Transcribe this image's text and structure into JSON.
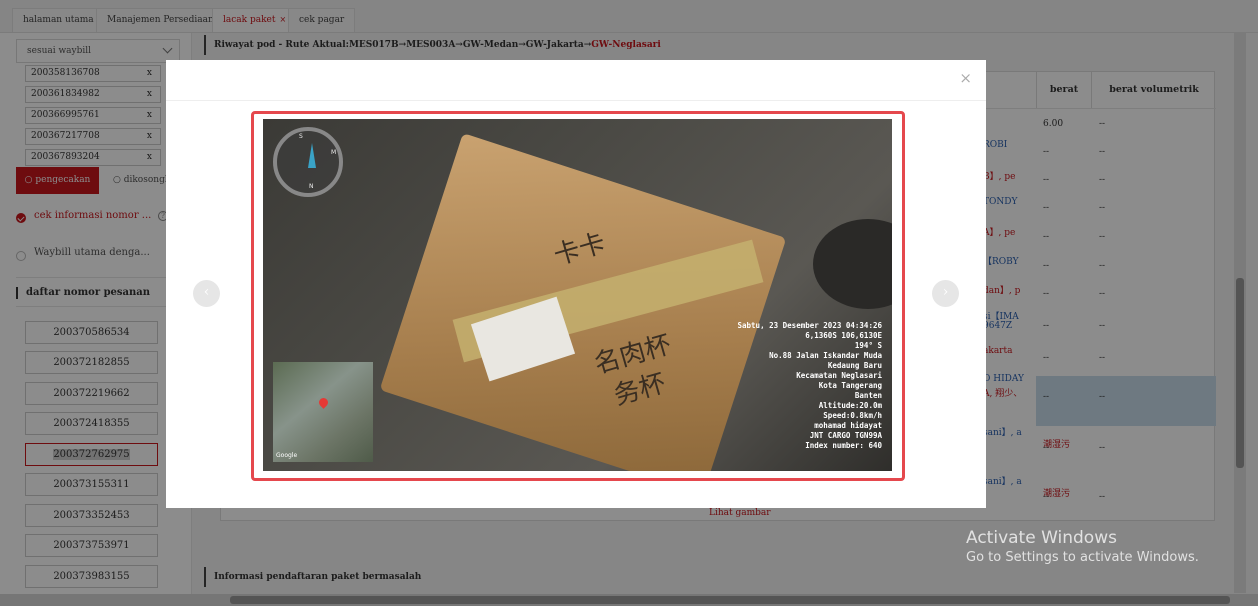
{
  "tabs": [
    {
      "label": "halaman utama"
    },
    {
      "label": "Manajemen Persediaan"
    },
    {
      "label": "lacak paket",
      "close": "×"
    },
    {
      "label": "cek pagar"
    }
  ],
  "left": {
    "select_value": "sesuai waybill",
    "waybills": [
      {
        "value": "200358136708",
        "remove": "x"
      },
      {
        "value": "200361834982",
        "remove": "x"
      },
      {
        "value": "200366995761",
        "remove": "x"
      },
      {
        "value": "200367217708",
        "remove": "x"
      },
      {
        "value": "200367893204",
        "remove": "x"
      }
    ],
    "search_button": "pengecakan",
    "clear_button": "dikosongkan",
    "option1": "cek informasi nomor ...",
    "option2": "Waybill utama denga...",
    "help": "?",
    "orders_title": "daftar nomor pesanan",
    "orders": [
      "200370586534",
      "200372182855",
      "200372219662",
      "200372418355",
      "200372762975",
      "200373155311",
      "200373352453",
      "200373753971",
      "200373983155"
    ],
    "active_order": "200372762975"
  },
  "main": {
    "pod_title_prefix": "Riwayat pod - Rute Aktual:MES017B→MES003A→GW-Medan→GW-Jakarta→",
    "pod_title_last": "GW-Neglasari",
    "headers": {
      "berat": "berat",
      "berat_vol": "berat volumetrik"
    },
    "rows": [
      {
        "frag": "",
        "berat": "6.00",
        "vol": "--"
      },
      {
        "frag": "ROBI",
        "berat": "--",
        "vol": "--"
      },
      {
        "frag": "B】, pe",
        "berat": "--",
        "vol": "--"
      },
      {
        "frag": "TONDY",
        "berat": "--",
        "vol": "--"
      },
      {
        "frag": "A】, pe",
        "berat": "--",
        "vol": "--"
      },
      {
        "frag": "【ROBY",
        "berat": "--",
        "vol": "--"
      },
      {
        "frag": "dan】, p",
        "berat": "--",
        "vol": "--"
      },
      {
        "frag": "si【IMA",
        "frag2": "9647Z",
        "berat": "--",
        "vol": "--"
      },
      {
        "frag": "akarta",
        "berat": "--",
        "vol": "--"
      },
      {
        "frag": "O HIDAY",
        "frag2": "A, 翔少、",
        "berat": "--",
        "vol": "--"
      },
      {
        "frag": "sani】, a",
        "frag2": "潮湿污",
        "berat": "--",
        "vol": "--"
      },
      {
        "frag": "sani】, a",
        "frag2": "潮湿污",
        "berat": "--",
        "vol": "--"
      }
    ],
    "footer_link": "Lihat gambar",
    "problem_title": "Informasi pendaftaran paket bermasalah"
  },
  "modal": {
    "close": "×",
    "prev": "‹",
    "next": "›",
    "photo": {
      "compass_n": "N",
      "compass_s": "S",
      "compass_m": "M",
      "box_text_1": "卡卡",
      "box_text_2": "名肉杯",
      "box_text_3": "务杯",
      "map_label": "Google",
      "stamp_lines": [
        "Sabtu, 23 Desember 2023 04:34:26",
        "6,1360S 106,6130E",
        "194° S",
        "No.88 Jalan Iskandar Muda",
        "Kedaung Baru",
        "Kecamatan Neglasari",
        "Kota Tangerang",
        "Banten",
        "Altitude:20.0m",
        "Speed:0.8km/h",
        "mohamad hidayat",
        "JNT CARGO TGN99A",
        "Index number: 640"
      ]
    }
  },
  "watermark": {
    "line1": "Activate Windows",
    "line2": "Go to Settings to activate Windows."
  }
}
